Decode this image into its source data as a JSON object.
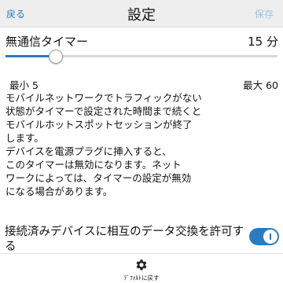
{
  "header": {
    "back_label": "戻る",
    "title": "設定",
    "save_label": "保存"
  },
  "timer": {
    "label": "無通信タイマー",
    "value": "15 分",
    "min": 5,
    "max": 60,
    "current": 15,
    "min_label": "最小 5",
    "max_label": "最大 60"
  },
  "description": {
    "lines": [
      "モバイルネットワークでトラフィックがない",
      "状態がタイマーで設定された時間まで続くと",
      "モバイルホットスポットセッションが終了",
      "します。",
      "デバイスを電源プラグに挿入すると、",
      "このタイマーは無効になります。ネット",
      "ワークによっては、タイマーの設定が無効",
      "になる場合があります。"
    ]
  },
  "data_exchange": {
    "label": "接続済みデバイスに相互のデータ交換を許可する",
    "enabled": true
  },
  "footer": {
    "reset_label": "ﾃﾞﾌｫﾙﾄに戻す",
    "reset_icon": "gear-icon"
  },
  "colors": {
    "accent": "#2b7bbf",
    "save_disabled": "#9cc3e3",
    "header_bg": "#eeeeee"
  }
}
